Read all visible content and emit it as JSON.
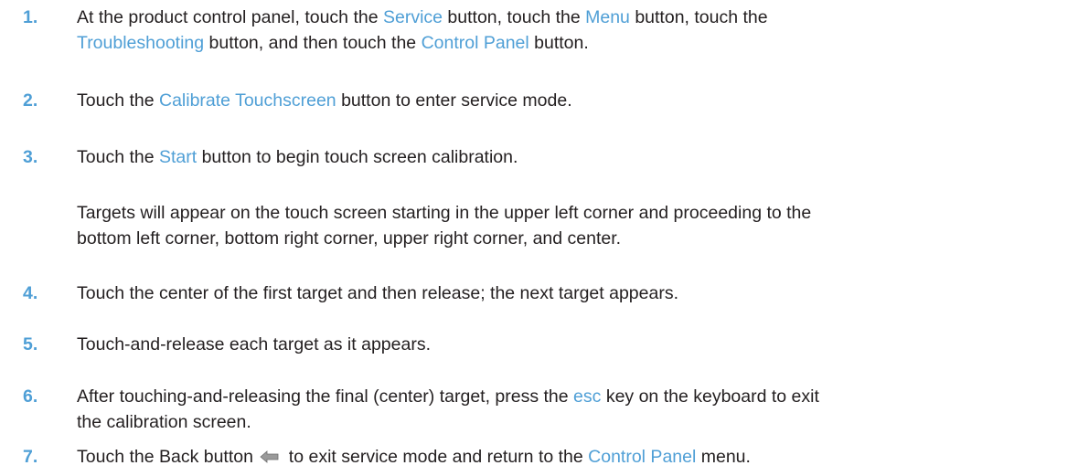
{
  "steps": [
    {
      "number": "1.",
      "lines": [
        {
          "parts": [
            "At the product control panel, touch the ",
            "Service",
            " button, touch the ",
            "Menu",
            " button, touch the"
          ]
        },
        {
          "parts": [
            "Troubleshooting",
            " button, and then touch the ",
            "Control Panel",
            " button."
          ]
        }
      ]
    },
    {
      "number": "2.",
      "lines": [
        {
          "parts": [
            "Touch the ",
            "Calibrate Touchscreen",
            " button to enter service mode."
          ]
        }
      ]
    },
    {
      "number": "3.",
      "lines": [
        {
          "parts": [
            "Touch the ",
            "Start",
            " button to begin touch screen calibration."
          ]
        }
      ]
    },
    {
      "number": "",
      "lines": [
        {
          "parts": [
            "Targets will appear on the touch screen starting in the upper left corner and proceeding to the"
          ]
        },
        {
          "parts": [
            "bottom left corner, bottom right corner, upper right corner, and center."
          ]
        }
      ]
    },
    {
      "number": "4.",
      "lines": [
        {
          "parts": [
            "Touch the center of the first target and then release; the next target appears."
          ]
        }
      ]
    },
    {
      "number": "5.",
      "lines": [
        {
          "parts": [
            "Touch-and-release each target as it appears."
          ]
        }
      ]
    },
    {
      "number": "6.",
      "lines": [
        {
          "parts": [
            "After touching-and-releasing the final (center) target, press the ",
            "esc",
            " key on the keyboard to exit"
          ]
        },
        {
          "parts": [
            "the calibration screen."
          ]
        }
      ]
    },
    {
      "number": "7.",
      "lines": [
        {
          "parts": [
            "Touch the Back button ",
            " to exit service mode and return to the ",
            "Control Panel",
            " menu."
          ]
        }
      ]
    }
  ],
  "accent_color": "#4f9fd6",
  "text_color": "#231f20",
  "back_icon": "back-arrow-icon"
}
